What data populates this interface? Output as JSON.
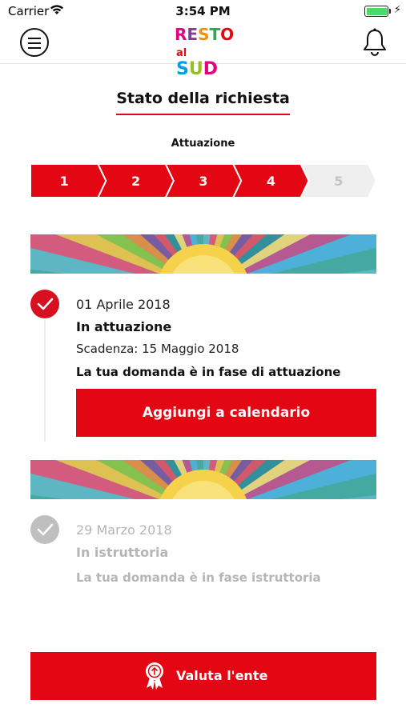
{
  "status_bar": {
    "carrier": "Carrier",
    "time": "3:54 PM",
    "battery_level": 1.0
  },
  "nav": {
    "menu_icon": "hamburger-menu-icon",
    "logo": {
      "line1": "RESTO",
      "line2": "al SUD"
    },
    "bell_icon": "bell-icon"
  },
  "page": {
    "title": "Stato della richiesta",
    "phase_label": "Attuazione"
  },
  "stepper": {
    "steps": [
      "1",
      "2",
      "3",
      "4",
      "5"
    ],
    "completed_count": 4,
    "active_color": "#e30613",
    "inactive_color": "#efefef"
  },
  "timeline": [
    {
      "date": "01 Aprile 2018",
      "status": "In attuazione",
      "deadline": "Scadenza: 15 Maggio 2018",
      "description": "La tua domanda è in fase di attuazione",
      "action_label": "Aggiungi a calendario",
      "state": "active"
    },
    {
      "date": "29 Marzo 2018",
      "status": "In istruttoria",
      "description": "La tua domanda è in fase istruttoria",
      "state": "done"
    }
  ],
  "footer": {
    "rate_label": "Valuta l'ente",
    "rate_icon": "award-ribbon-icon"
  },
  "colors": {
    "brand_red": "#e30613",
    "muted_gray": "#b5b5b5"
  }
}
